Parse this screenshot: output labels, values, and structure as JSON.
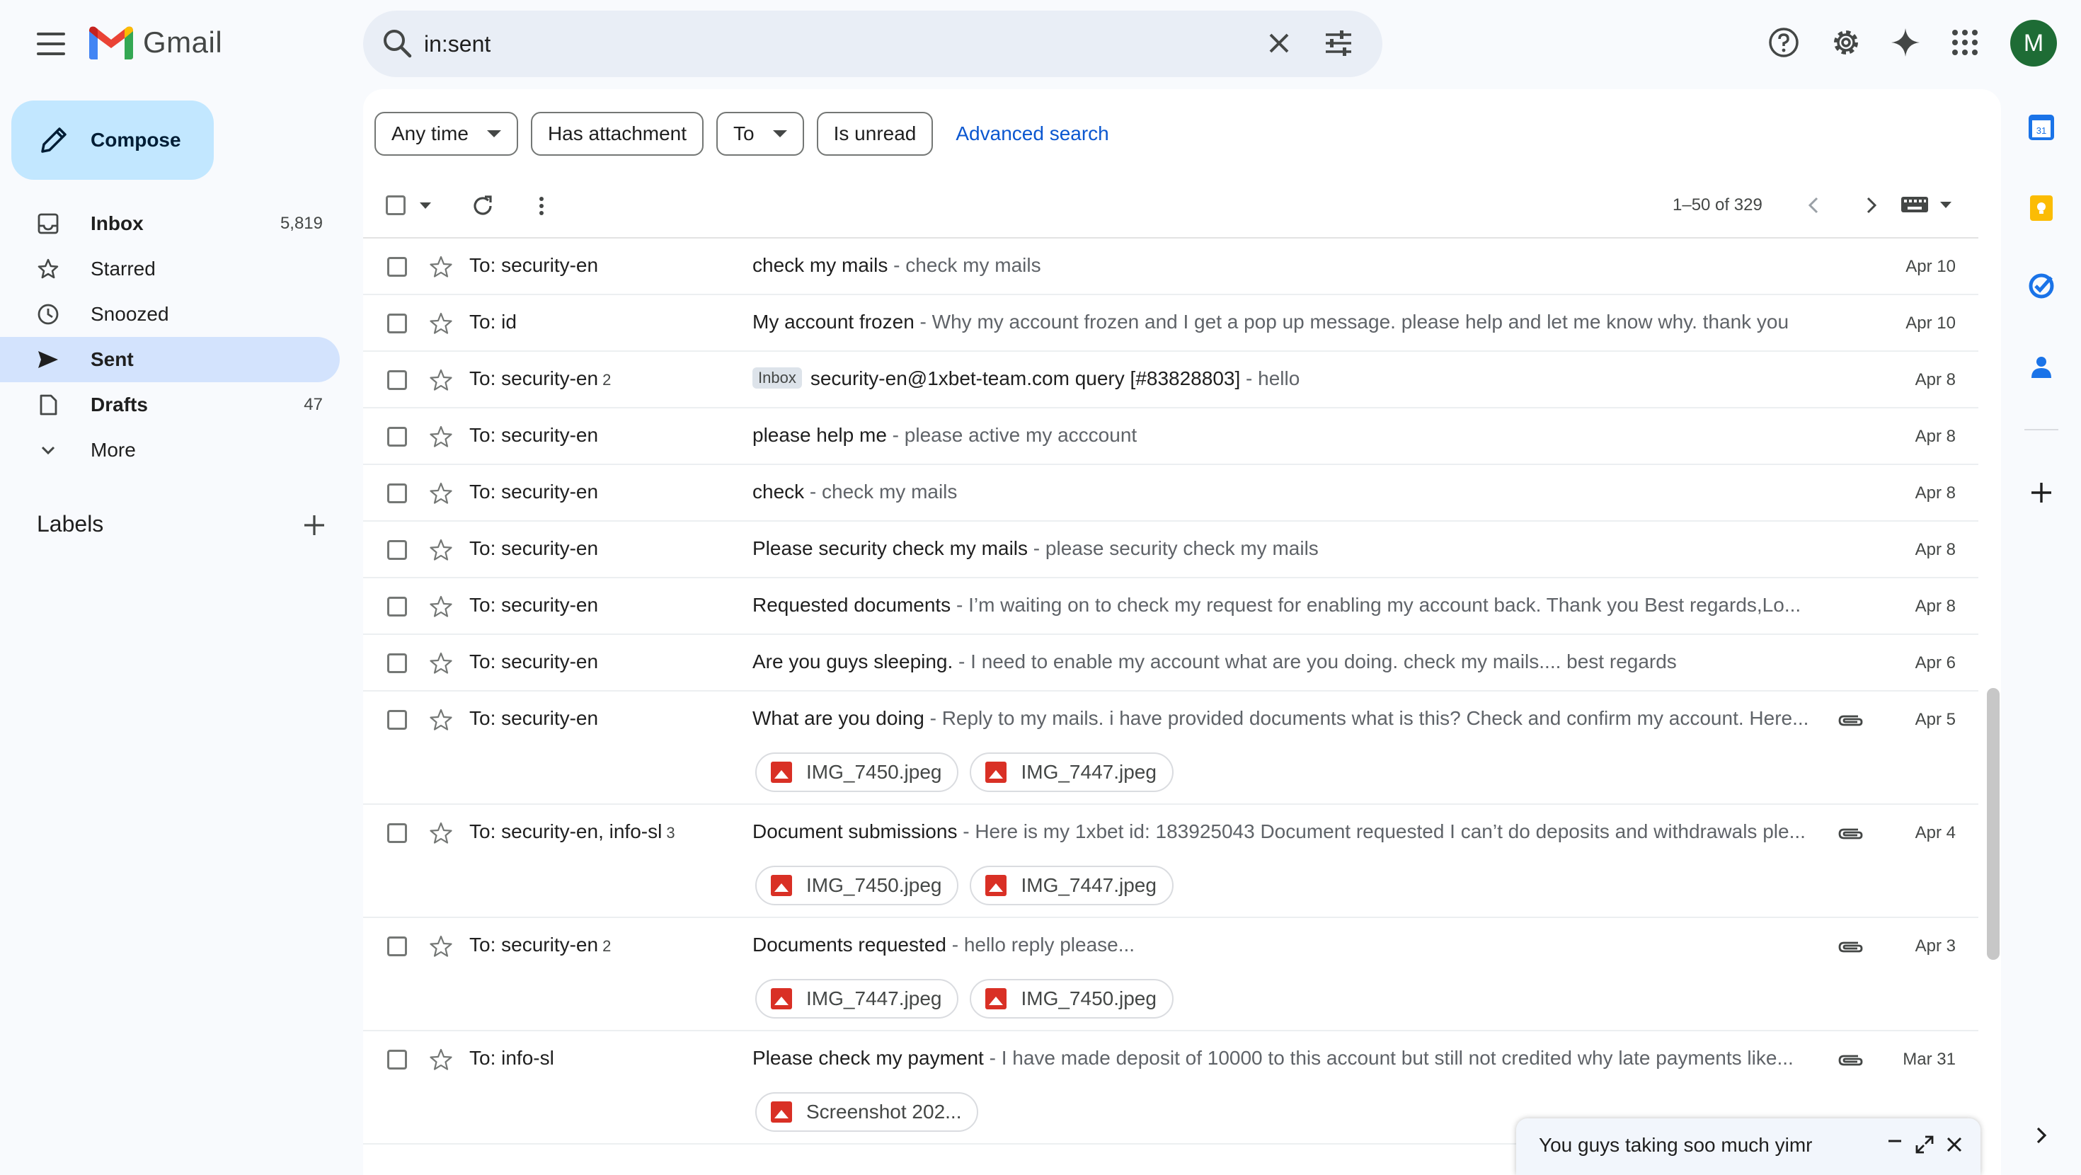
{
  "app": {
    "name": "Gmail",
    "avatar_letter": "M"
  },
  "search": {
    "value": "in:sent"
  },
  "compose": {
    "label": "Compose"
  },
  "sidebar": {
    "items": [
      {
        "label": "Inbox",
        "count": "5,819",
        "icon": "inbox-icon"
      },
      {
        "label": "Starred",
        "count": "",
        "icon": "star-icon"
      },
      {
        "label": "Snoozed",
        "count": "",
        "icon": "clock-icon"
      },
      {
        "label": "Sent",
        "count": "",
        "icon": "send-icon"
      },
      {
        "label": "Drafts",
        "count": "47",
        "icon": "draft-icon"
      },
      {
        "label": "More",
        "count": "",
        "icon": "chevron-down-icon"
      }
    ],
    "labels_heading": "Labels"
  },
  "filters": {
    "any_time": "Any time",
    "has_attachment": "Has attachment",
    "to": "To",
    "is_unread": "Is unread",
    "advanced": "Advanced search"
  },
  "pager": {
    "range": "1–50 of 329"
  },
  "emails": [
    {
      "sender": "To: security-en",
      "count": "",
      "tag": "",
      "subject": "check my mails",
      "snippet": " - check my mails",
      "date": "Apr 10",
      "attachments": []
    },
    {
      "sender": "To: id",
      "count": "",
      "tag": "",
      "subject": "My account frozen",
      "snippet": " - Why my account frozen and I get a pop up message. please help and let me know why. thank you",
      "date": "Apr 10",
      "attachments": []
    },
    {
      "sender": "To: security-en",
      "count": "2",
      "tag": "Inbox",
      "subject": "security-en@1xbet-team.com query [#83828803]",
      "snippet": " - hello",
      "date": "Apr 8",
      "attachments": []
    },
    {
      "sender": "To: security-en",
      "count": "",
      "tag": "",
      "subject": "please help me",
      "snippet": " - please active my acccount",
      "date": "Apr 8",
      "attachments": []
    },
    {
      "sender": "To: security-en",
      "count": "",
      "tag": "",
      "subject": "check",
      "snippet": " - check my mails",
      "date": "Apr 8",
      "attachments": []
    },
    {
      "sender": "To: security-en",
      "count": "",
      "tag": "",
      "subject": "Please security check my mails",
      "snippet": " - please security check my mails",
      "date": "Apr 8",
      "attachments": []
    },
    {
      "sender": "To: security-en",
      "count": "",
      "tag": "",
      "subject": "Requested documents",
      "snippet": " - I’m waiting on to check my request for enabling my account back. Thank you Best regards,Lo...",
      "date": "Apr 8",
      "attachments": []
    },
    {
      "sender": "To: security-en",
      "count": "",
      "tag": "",
      "subject": "Are you guys sleeping.",
      "snippet": " - I need to enable my account what are you doing. check my mails.... best regards",
      "date": "Apr 6",
      "attachments": []
    },
    {
      "sender": "To: security-en",
      "count": "",
      "tag": "",
      "subject": "What are you doing",
      "snippet": " - Reply to my mails. i have provided documents what is this? Check and confirm my account. Here...",
      "date": "Apr 5",
      "attachments": [
        "IMG_7450.jpeg",
        "IMG_7447.jpeg"
      ]
    },
    {
      "sender": "To: security-en, info-sl",
      "count": "3",
      "tag": "",
      "subject": "Document submissions",
      "snippet": " - Here is my 1xbet id: 183925043 Document requested I can’t do deposits and withdrawals ple...",
      "date": "Apr 4",
      "attachments": [
        "IMG_7450.jpeg",
        "IMG_7447.jpeg"
      ]
    },
    {
      "sender": "To: security-en",
      "count": "2",
      "tag": "",
      "subject": "Documents requested",
      "snippet": " - hello reply please...",
      "date": "Apr 3",
      "attachments": [
        "IMG_7447.jpeg",
        "IMG_7450.jpeg"
      ]
    },
    {
      "sender": "To: info-sl",
      "count": "",
      "tag": "",
      "subject": "Please check my payment",
      "snippet": " - I have made deposit of 10000 to this account but still not credited why late payments like...",
      "date": "Mar 31",
      "attachments": [
        "Screenshot 202..."
      ]
    }
  ],
  "popup": {
    "title": "You guys taking soo much yimr"
  },
  "colors": {
    "accent": "#0b57d0",
    "compose_bg": "#c2e7ff",
    "active_nav": "#d3e3fd",
    "avatar": "#1e6c35"
  }
}
